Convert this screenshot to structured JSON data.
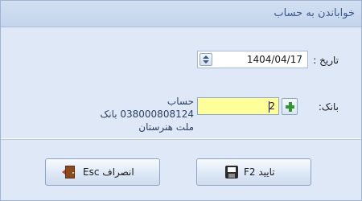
{
  "window": {
    "title": "خواباندن به حساب"
  },
  "form": {
    "date_label": "تاریخ :",
    "date_value": "1404/04/17",
    "bank_label": "بانک:",
    "bank_code": "2",
    "bank_description": "حساب 038000808124 بانک ملت هنرستان"
  },
  "buttons": {
    "confirm_label": "تایید F2",
    "cancel_label": "انصراف Esc"
  },
  "icons": {
    "date_spinner": "spinner-icon",
    "add": "plus-icon",
    "save": "floppy-disk-icon",
    "exit": "exit-door-icon"
  },
  "colors": {
    "background": "#dfe8f6",
    "title_text": "#3a5a8a",
    "bank_input_background": "#ffff99",
    "plus_green": "#2e9a2e"
  }
}
